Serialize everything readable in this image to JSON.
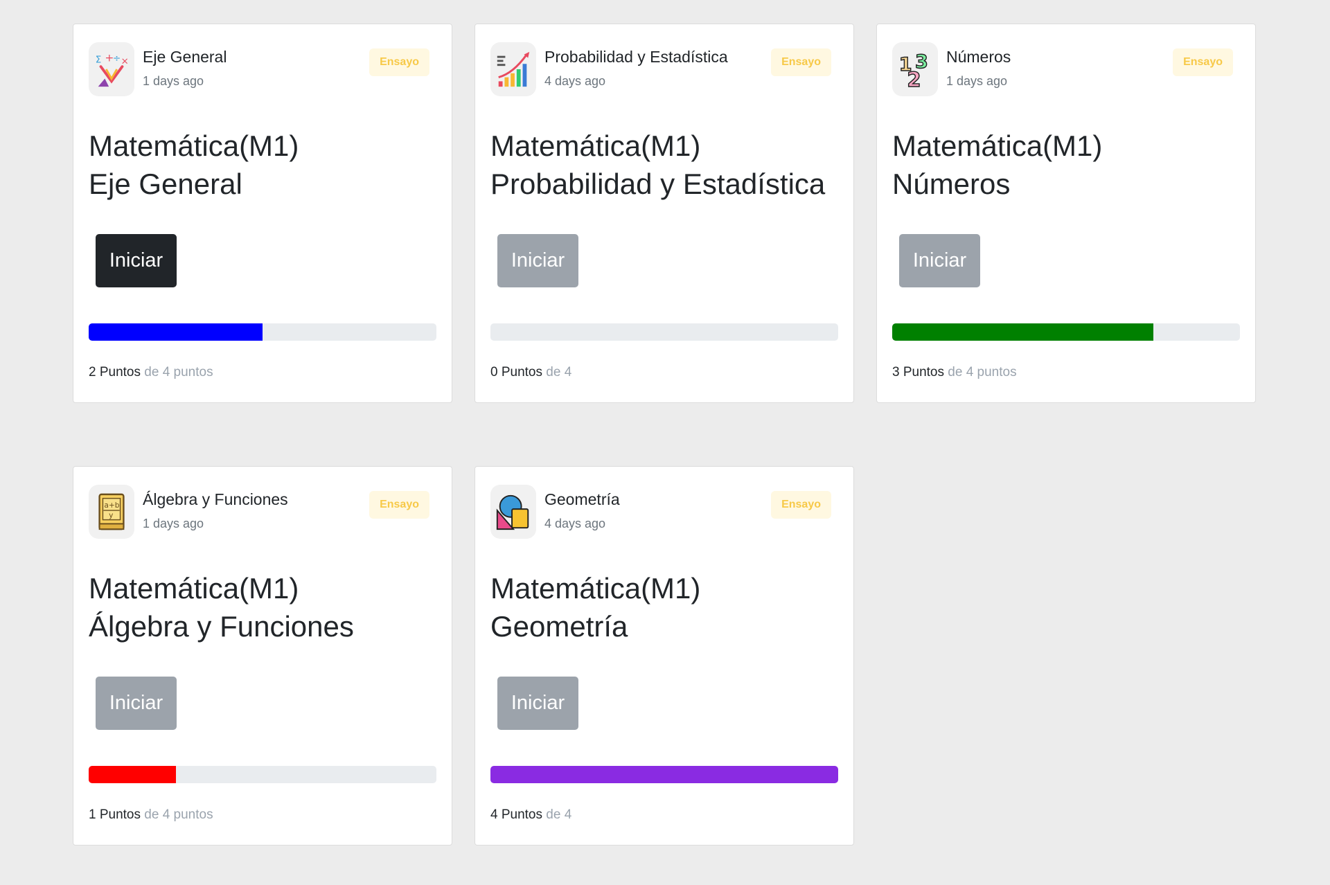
{
  "cards": [
    {
      "topic": "Eje General",
      "time": "1 days ago",
      "badge": "Ensayo",
      "title_line1": "Matemática(M1)",
      "title_line2": "Eje General",
      "button": "Iniciar",
      "button_state": "active",
      "progress": 0.5,
      "progress_color": "#0000ff",
      "score_value": "2 Puntos",
      "score_suffix": "de 4 puntos",
      "icon": "math-symbols-icon"
    },
    {
      "topic": "Probabilidad y Estadística",
      "time": "4 days ago",
      "badge": "Ensayo",
      "title_line1": "Matemática(M1)",
      "title_line2": "Probabilidad y Estadística",
      "button": "Iniciar",
      "button_state": "inactive",
      "progress": 0,
      "progress_color": "#e9ecef",
      "score_value": "0 Puntos",
      "score_suffix": "de 4",
      "icon": "bar-chart-icon"
    },
    {
      "topic": "Números",
      "time": "1 days ago",
      "badge": "Ensayo",
      "title_line1": "Matemática(M1)",
      "title_line2": "Números",
      "button": "Iniciar",
      "button_state": "inactive",
      "progress": 0.75,
      "progress_color": "#008000",
      "score_value": "3 Puntos",
      "score_suffix": "de 4 puntos",
      "icon": "numbers-123-icon"
    },
    {
      "topic": "Álgebra y Funciones",
      "time": "1 days ago",
      "badge": "Ensayo",
      "title_line1": "Matemática(M1)",
      "title_line2": "Álgebra y Funciones",
      "button": "Iniciar",
      "button_state": "inactive",
      "progress": 0.25,
      "progress_color": "#ff0000",
      "score_value": "1 Puntos",
      "score_suffix": "de 4 puntos",
      "icon": "algebra-book-icon"
    },
    {
      "topic": "Geometría",
      "time": "4 days ago",
      "badge": "Ensayo",
      "title_line1": "Matemática(M1)",
      "title_line2": "Geometría",
      "button": "Iniciar",
      "button_state": "inactive",
      "progress": 1,
      "progress_color": "#8a2be2",
      "score_value": "4 Puntos",
      "score_suffix": "de 4",
      "icon": "geometry-shapes-icon"
    }
  ]
}
